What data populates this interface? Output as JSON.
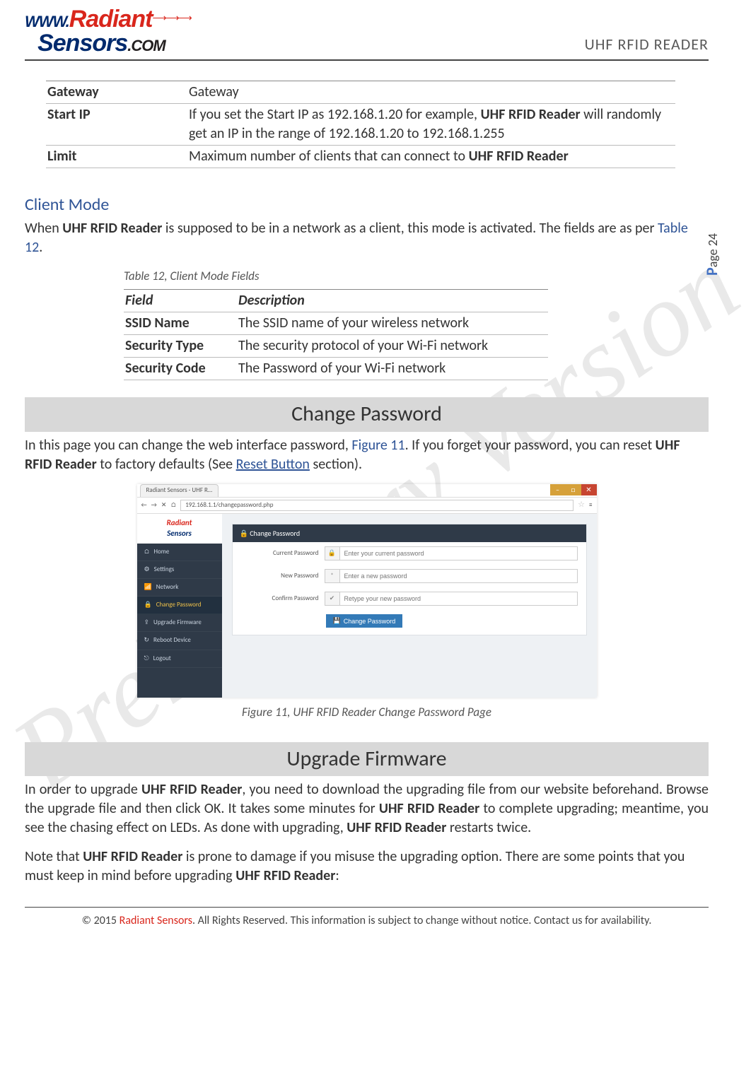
{
  "header": {
    "logo_www": "WWW.",
    "logo_radiant": "Radiant",
    "logo_sensors": "Sensors",
    "logo_com": ".COM",
    "doc_title": "UHF RFID READER"
  },
  "page_label_prefix": "P",
  "page_label_rest": "age 24",
  "watermark": "Preliminary Version",
  "table1": {
    "rows": [
      {
        "field": "Gateway",
        "desc": "Gateway",
        "desc_bold1": "",
        "desc_rest": ""
      },
      {
        "field": "Start IP",
        "desc": "If you set the Start IP as 192.168.1.20 for example, ",
        "desc_bold1": "UHF RFID Reader",
        "desc_rest": " will randomly get an IP in the range of 192.168.1.20 to 192.168.1.255"
      },
      {
        "field": "Limit",
        "desc": "Maximum number of clients that can connect to ",
        "desc_bold1": "UHF RFID Reader",
        "desc_rest": ""
      }
    ]
  },
  "client_mode": {
    "heading": "Client Mode",
    "para_pre": "When ",
    "para_bold": "UHF RFID Reader",
    "para_mid": " is supposed to be in a network as a client, this mode is activated. The fields are as per ",
    "para_link": "Table 12",
    "para_end": "."
  },
  "table12": {
    "caption": "Table 12, Client Mode Fields",
    "head_field": "Field",
    "head_desc": "Description",
    "rows": [
      {
        "field": "SSID Name",
        "desc": "The SSID name of your wireless network"
      },
      {
        "field": "Security Type",
        "desc": "The security protocol of your Wi-Fi network"
      },
      {
        "field": "Security Code",
        "desc": "The Password of your Wi-Fi network"
      }
    ]
  },
  "change_password": {
    "heading": "Change Password",
    "para_pre": "In this page you can change the web interface password, ",
    "para_link1": "Figure 11",
    "para_mid": ". If you forget your password, you can reset ",
    "para_bold": "UHF RFID Reader",
    "para_mid2": " to factory defaults (See ",
    "para_link2": "Reset Button",
    "para_end": " section)."
  },
  "figure11_caption": "Figure 11, UHF RFID Reader Change Password Page",
  "screenshot": {
    "tab": "Radiant Sensors - UHF R…",
    "url": "192.168.1.1/changepassword.php",
    "brand1": "Radiant",
    "brand2": "Sensors",
    "panel_title": "Change Password",
    "nav": {
      "home": "Home",
      "settings": "Settings",
      "network": "Network",
      "change_password": "Change Password",
      "upgrade_firmware": "Upgrade Firmware",
      "reboot_device": "Reboot Device",
      "logout": "Logout"
    },
    "form": {
      "current_label": "Current Password",
      "current_placeholder": "Enter your current password",
      "new_label": "New Password",
      "new_placeholder": "Enter a new password",
      "confirm_label": "Confirm Password",
      "confirm_placeholder": "Retype your new password",
      "button": "Change Password"
    }
  },
  "upgrade": {
    "heading": "Upgrade Firmware",
    "p1_a": "In order to upgrade ",
    "p1_bold1": "UHF RFID Reader",
    "p1_b": ", you need to download the upgrading file from our website beforehand. Browse the upgrade file and then click OK. It takes some minutes for ",
    "p1_bold2": "UHF RFID Reader",
    "p1_c": " to complete upgrading; meantime, you see the chasing effect on LEDs. As done with upgrading, ",
    "p1_bold3": "UHF RFID Reader",
    "p1_d": " restarts twice.",
    "p2_a": "Note that ",
    "p2_bold1": "UHF RFID Reader",
    "p2_b": " is prone to damage if you misuse the upgrading option. There are some points that you must keep in mind before upgrading ",
    "p2_bold2": "UHF RFID Reader",
    "p2_c": ":"
  },
  "footer": {
    "pre": "© 2015 ",
    "brand": "Radiant Sensors",
    "rest": ". All Rights Reserved. This information is subject to change without notice. Contact us for availability."
  }
}
